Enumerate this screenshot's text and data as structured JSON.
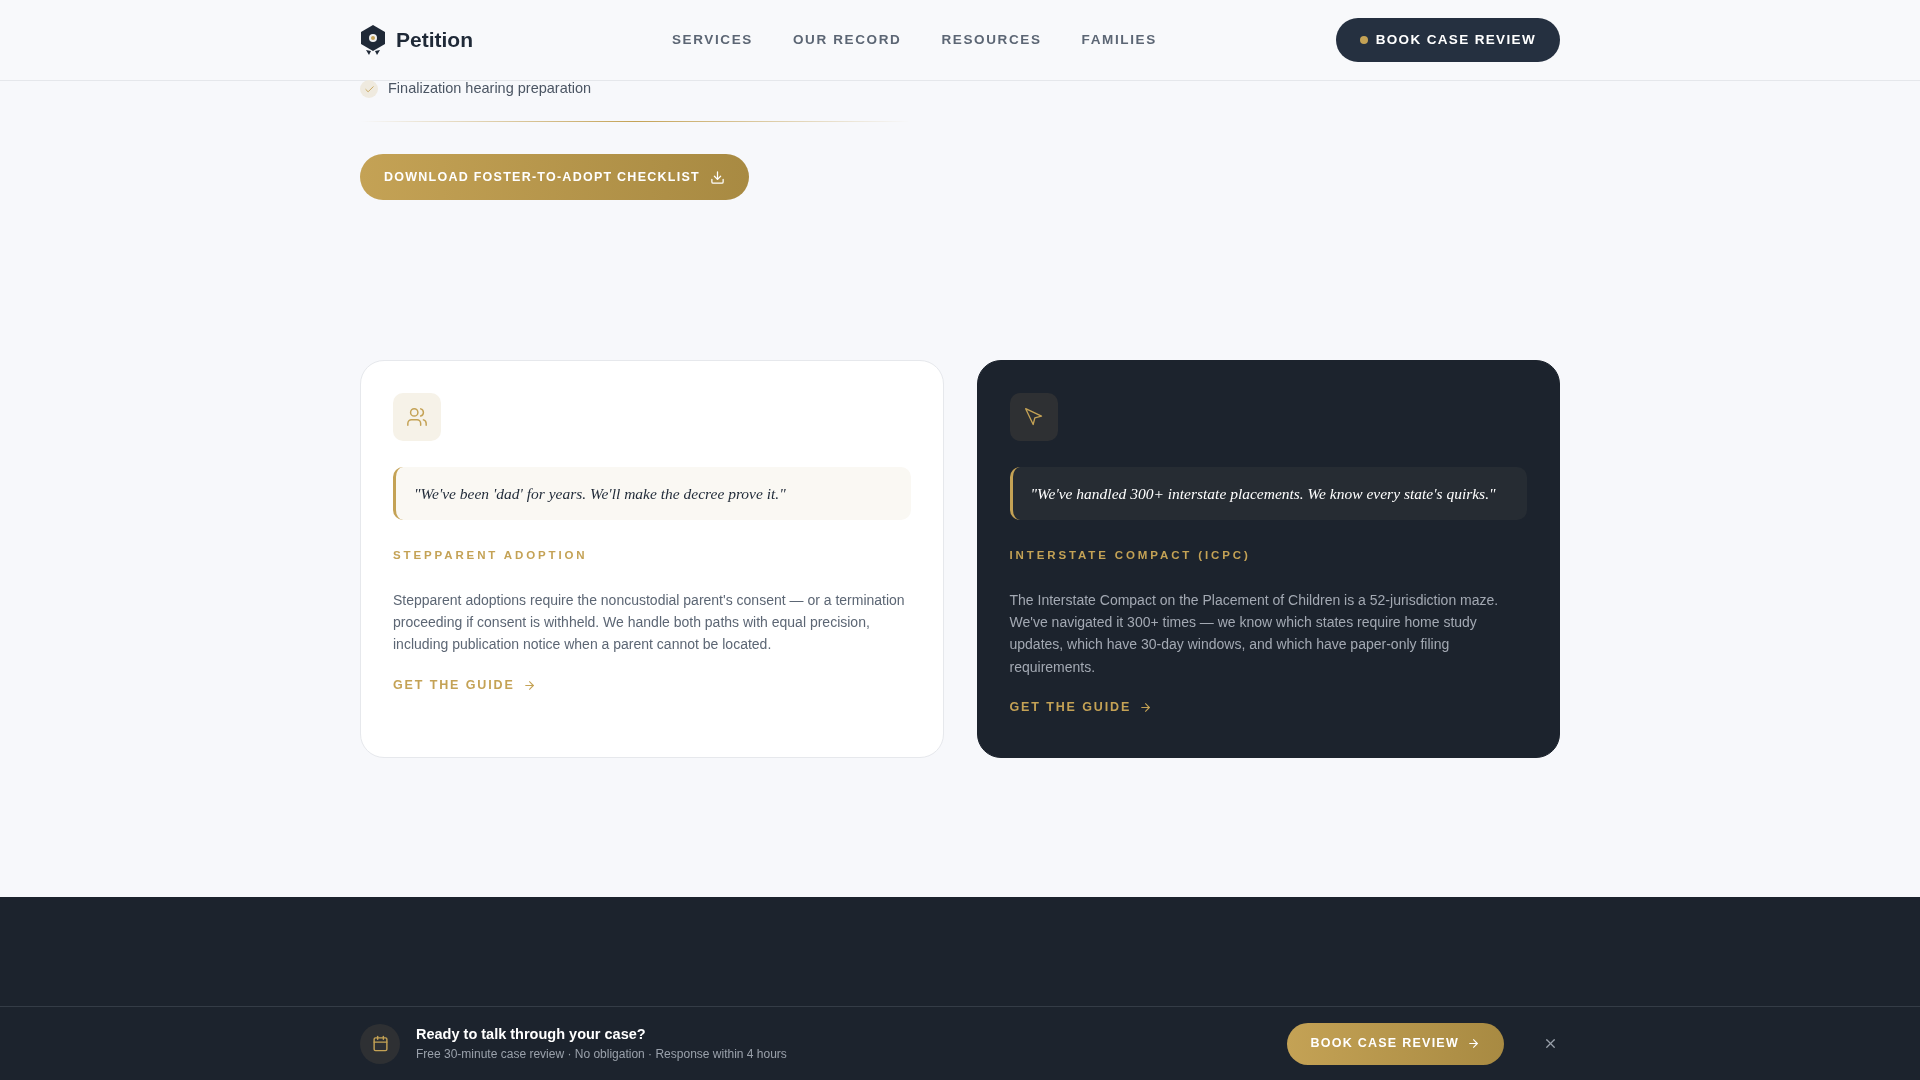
{
  "header": {
    "brand": "Petition",
    "nav": [
      "SERVICES",
      "OUR RECORD",
      "RESOURCES",
      "FAMILIES"
    ],
    "cta": "BOOK CASE REVIEW"
  },
  "checklist": {
    "items": [
      "Finalization hearing preparation"
    ],
    "download_button": "DOWNLOAD FOSTER-TO-ADOPT CHECKLIST"
  },
  "cards": [
    {
      "kind": "light",
      "quote": "\"We've been 'dad' for years. We'll make the decree prove it.\"",
      "title": "STEPPARENT ADOPTION",
      "body": "Stepparent adoptions require the noncustodial parent's consent — or a termination proceeding if consent is withheld. We handle both paths with equal precision, including publication notice when a parent cannot be located.",
      "link": "GET THE GUIDE"
    },
    {
      "kind": "dark",
      "quote": "\"We've handled 300+ interstate placements. We know every state's quirks.\"",
      "title": "INTERSTATE COMPACT (ICPC)",
      "body": "The Interstate Compact on the Placement of Children is a 52-jurisdiction maze. We've navigated it 300+ times — we know which states require home study updates, which have 30-day windows, and which have paper-only filing requirements.",
      "link": "GET THE GUIDE"
    }
  ],
  "bottom_bar": {
    "title": "Ready to talk through your case?",
    "subtitle": "Free 30-minute case review · No obligation · Response within 4 hours",
    "button": "BOOK CASE REVIEW"
  }
}
